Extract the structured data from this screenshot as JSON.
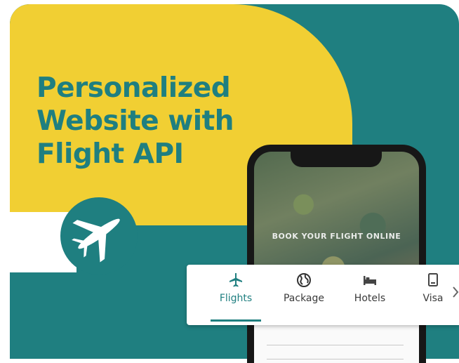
{
  "colors": {
    "teal": "#1f7f80",
    "yellow": "#f1cf33",
    "white": "#ffffff",
    "phone_frame": "#171717"
  },
  "hero": {
    "title_lines": [
      "Personalized",
      "Website with",
      "Flight API"
    ]
  },
  "phone": {
    "screen_caption": "BOOK YOUR FLIGHT ONLINE"
  },
  "nav": {
    "tabs": [
      {
        "label": "Flights",
        "icon": "airplane-icon",
        "active": true
      },
      {
        "label": "Package",
        "icon": "globe-icon",
        "active": false
      },
      {
        "label": "Hotels",
        "icon": "bed-icon",
        "active": false
      },
      {
        "label": "Visa",
        "icon": "document-icon",
        "active": false
      }
    ],
    "more_icon": "chevron-right-icon"
  }
}
